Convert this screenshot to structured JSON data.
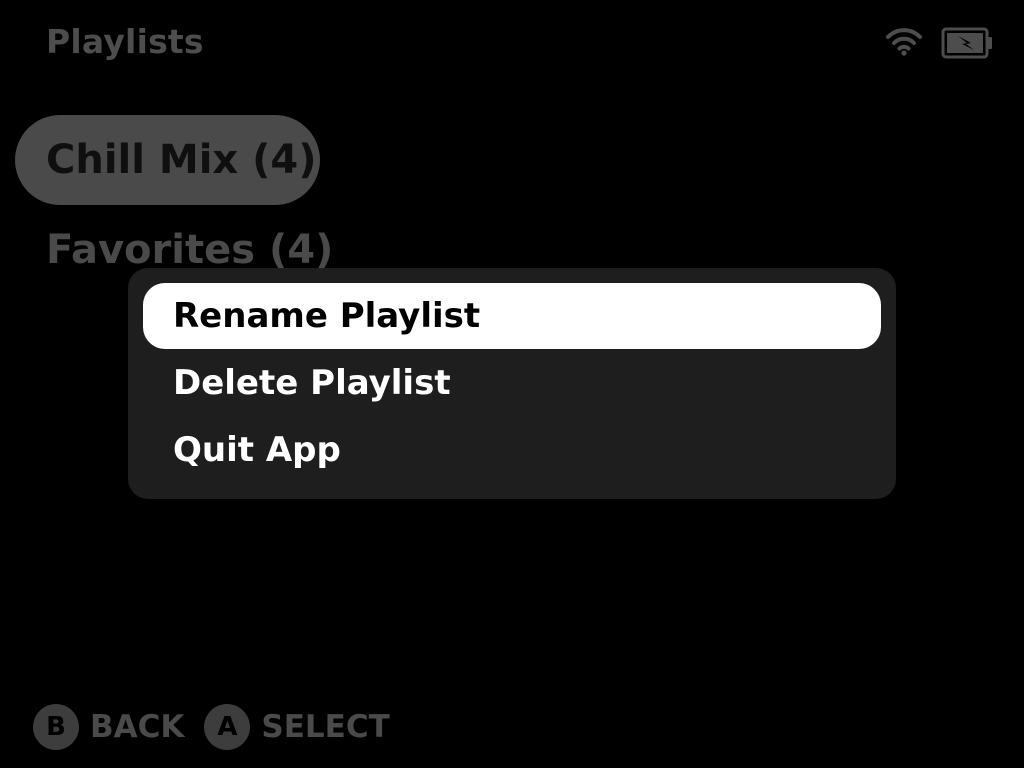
{
  "header": {
    "title": "Playlists"
  },
  "status": {
    "wifi_icon": "wifi-icon",
    "battery_icon": "battery-charging-icon"
  },
  "playlists": [
    {
      "label": "Chill Mix (4)",
      "selected": true
    },
    {
      "label": "Favorites (4)",
      "selected": false
    }
  ],
  "context_menu": {
    "items": [
      {
        "label": "Rename Playlist",
        "active": true
      },
      {
        "label": "Delete Playlist",
        "active": false
      },
      {
        "label": "Quit App",
        "active": false
      }
    ]
  },
  "footer": {
    "hints": [
      {
        "button": "B",
        "label": "BACK"
      },
      {
        "button": "A",
        "label": "SELECT"
      }
    ]
  },
  "colors": {
    "background": "#000000",
    "menu_background": "#1e1e1e",
    "highlight": "#ffffff",
    "dim_text": "#4a4a4a"
  }
}
